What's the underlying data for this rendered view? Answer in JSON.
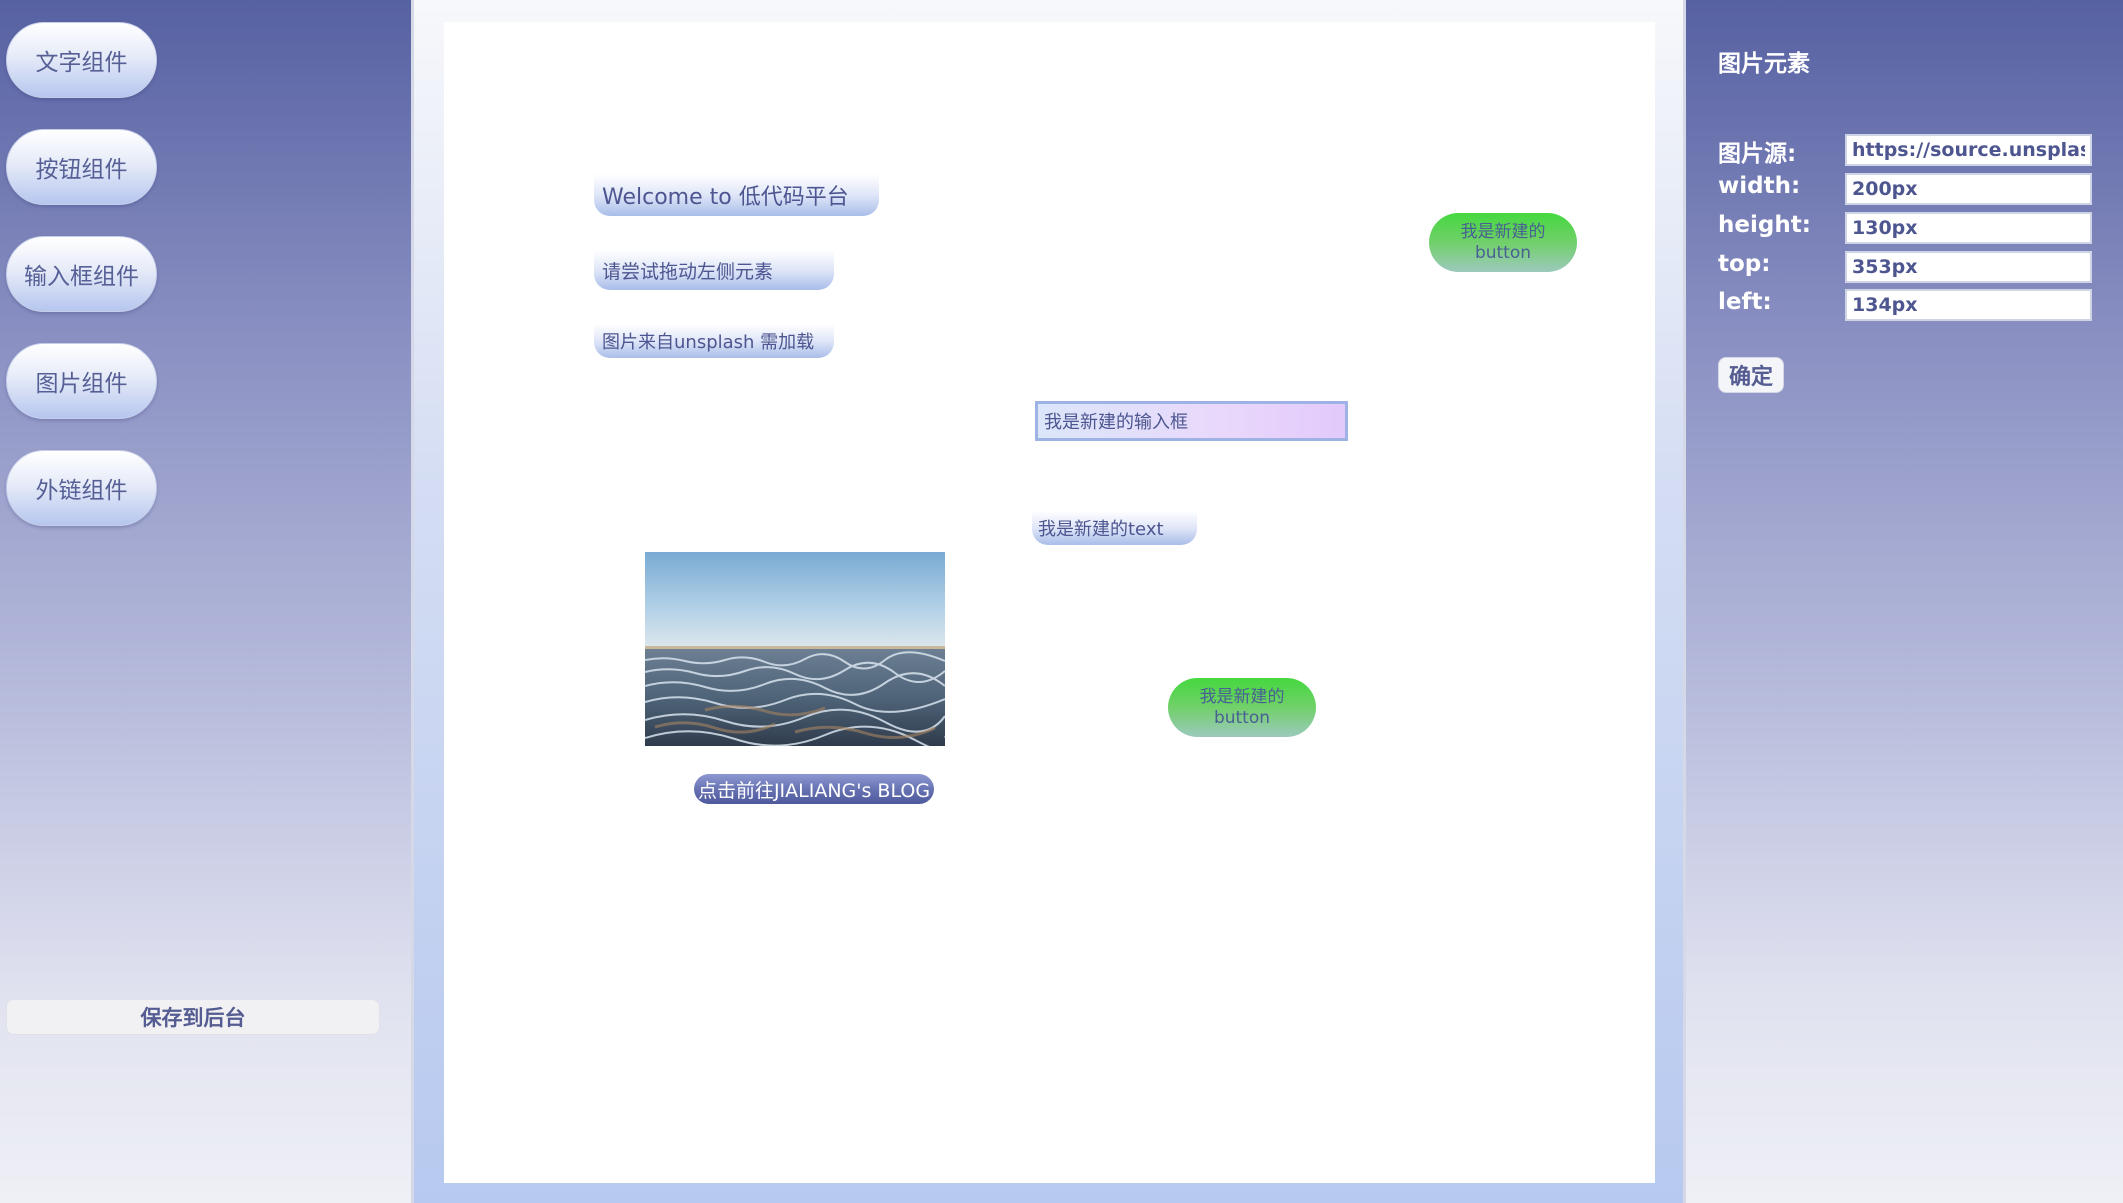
{
  "sidebar": {
    "components": [
      {
        "label": "文字组件"
      },
      {
        "label": "按钮组件"
      },
      {
        "label": "输入框组件"
      },
      {
        "label": "图片组件"
      },
      {
        "label": "外链组件"
      }
    ],
    "save_label": "保存到后台"
  },
  "canvas": {
    "welcome_text": "Welcome to 低代码平台",
    "drag_hint_text": "请尝试拖动左侧元素",
    "image_hint_text": "图片来自unsplash 需加载",
    "new_text": "我是新建的text",
    "new_input_value": "我是新建的输入框",
    "buttons": [
      {
        "line1": "我是新建的",
        "line2": "button"
      },
      {
        "line1": "我是新建的",
        "line2": "button"
      }
    ],
    "image_icon": "landscape-photo",
    "link_label": "点击前往JIALIANG's BLOG"
  },
  "panel": {
    "title": "图片元素",
    "fields": [
      {
        "label": "图片源:",
        "value": "https://source.unsplash.com"
      },
      {
        "label": "width:",
        "value": "200px"
      },
      {
        "label": "height:",
        "value": "130px"
      },
      {
        "label": "top:",
        "value": "353px"
      },
      {
        "label": "left:",
        "value": "134px"
      }
    ],
    "confirm_label": "确定"
  },
  "colors": {
    "sidebar_top": "#5661a2",
    "accent_text": "#4d5690",
    "button_green": "#45d83f",
    "link_bg": "#6470b0"
  }
}
